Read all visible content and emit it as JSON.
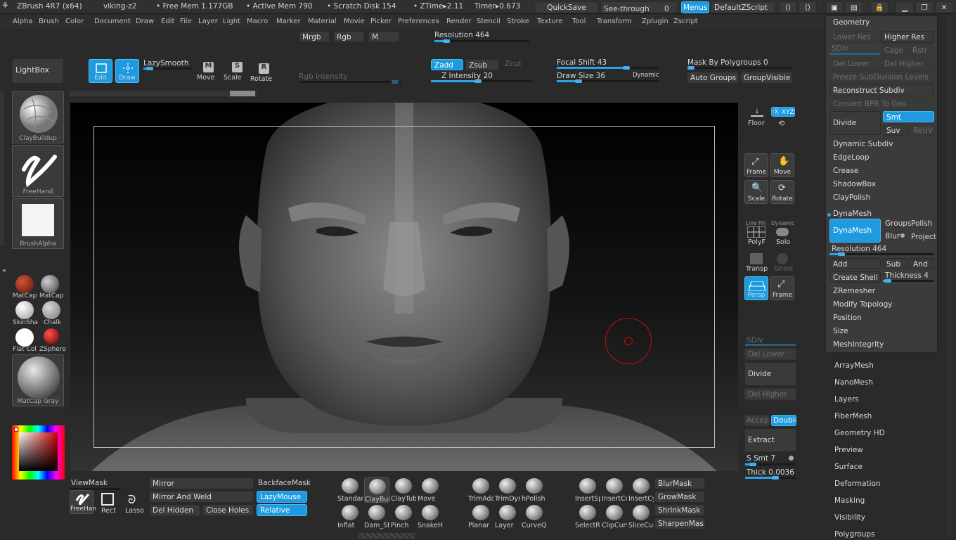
{
  "titlebar": {
    "app": "ZBrush 4R7 (x64)",
    "document": "viking-z2",
    "free_mem": "• Free Mem 1.177GB",
    "active_mem": "• Active Mem 790",
    "scratch": "• Scratch Disk 154",
    "ztime": "• ZTime▸2.11",
    "timer": "Timer▸0.673",
    "quicksave": "QuickSave",
    "see_through": "See-through",
    "see_through_value": "0",
    "menus": "Menus",
    "zscript": "DefaultZScript"
  },
  "menubar": [
    "Alpha",
    "Brush",
    "Color",
    "Document",
    "Draw",
    "Edit",
    "File",
    "Layer",
    "Light",
    "Macro",
    "Marker",
    "Material",
    "Movie",
    "Picker",
    "Preferences",
    "Render",
    "Stencil",
    "Stroke",
    "Texture",
    "Tool",
    "Transform",
    "Zplugin",
    "Zscript"
  ],
  "topshelf": {
    "mrgb": "Mrgb",
    "rgb": "Rgb",
    "m": "M",
    "resolution": "Resolution 464",
    "rgb_intensity": "Rgb Intensity",
    "lightbox": "LightBox",
    "edit": "Edit",
    "draw": "Draw",
    "lazysmooth": "LazySmooth",
    "move": "Move",
    "scale": "Scale",
    "rotate": "Rotate",
    "zadd": "Zadd",
    "zsub": "Zsub",
    "zcut": "Zcut",
    "z_intensity": "Z Intensity 20",
    "focal_shift": "Focal Shift 43",
    "draw_size": "Draw Size 36",
    "dynamic": "Dynamic",
    "mask_polygroups": "Mask By Polygroups 0",
    "auto_groups": "Auto Groups",
    "group_visible": "GroupVisible"
  },
  "leftshelf": {
    "brush": "ClayBuildup",
    "stroke": "FreeHand",
    "alpha": "BrushAlpha",
    "materials": [
      {
        "label": "MatCap",
        "color": "#8a2a1a"
      },
      {
        "label": "MatCap",
        "color": "#6e6e6e"
      },
      {
        "label": "SkinSha",
        "color": "#e6e6e6"
      },
      {
        "label": "Chalk",
        "color": "#9a9a9a"
      },
      {
        "label": "Flat Col",
        "color": "#ffffff"
      },
      {
        "label": "ZSphere",
        "color": "#b01818"
      }
    ],
    "current_material": "MatCap Gray"
  },
  "rightshelf": {
    "floor": "Floor",
    "xyz": "Ⓧ XYZ",
    "frame": "Frame",
    "move": "Move",
    "scale": "Scale",
    "rotate": "Rotate",
    "polyf": "PolyF",
    "line_fill": "Line Fill",
    "dynamic": "Dynamic",
    "solo": "Solo",
    "transp": "Transp",
    "ghost": "Ghost",
    "persp": "Persp",
    "frame2": "Frame",
    "sdiv": "SDiv",
    "del_lower": "Del Lower",
    "divide": "Divide",
    "del_higher": "Del Higher",
    "accept": "Accept",
    "double": "Double",
    "extract": "Extract",
    "s_smt": "S Smt 7",
    "thick": "Thick 0.0036"
  },
  "geometry": {
    "title": "Geometry",
    "lower_res": "Lower Res",
    "higher_res": "Higher Res",
    "sdiv": "SDiv",
    "cage": "Cage",
    "rstr": "Rstr",
    "del_lower": "Del Lower",
    "del_higher": "Del Higher",
    "freeze": "Freeze SubDivision Levels",
    "reconstruct": "Reconstruct Subdiv",
    "convert": "Convert BPR To Geo",
    "divide": "Divide",
    "smt": "Smt",
    "suv": "Suv",
    "reuv": "ReUV",
    "items": [
      "Dynamic Subdiv",
      "EdgeLoop",
      "Crease",
      "ShadowBox",
      "ClayPolish"
    ],
    "dynamesh_title": "DynaMesh",
    "dynamesh_btn": "DynaMesh",
    "groups": "Groups",
    "polish": "Polish",
    "blur": "Blur",
    "project": "Project",
    "resolution": "Resolution 464",
    "add": "Add",
    "sub": "Sub",
    "and": "And",
    "create_shell": "Create Shell",
    "thickness": "Thickness 4",
    "items2": [
      "ZRemesher",
      "Modify Topology",
      "Position",
      "Size",
      "MeshIntegrity"
    ]
  },
  "subpalettes": [
    "ArrayMesh",
    "NanoMesh",
    "Layers",
    "FiberMesh",
    "Geometry HD",
    "Preview",
    "Surface",
    "Deformation",
    "Masking",
    "Visibility",
    "Polygroups"
  ],
  "bottom": {
    "viewmask": "ViewMask",
    "mirror": "Mirror",
    "mirror_weld": "Mirror And Weld",
    "del_hidden": "Del Hidden",
    "close_holes": "Close Holes",
    "backface": "BackfaceMask",
    "lazymouse": "LazyMouse",
    "relative": "Relative",
    "freehand": "FreeHan",
    "rect": "Rect",
    "lasso": "Lasso",
    "brushes_row1": [
      "Standar",
      "ClayBuil",
      "ClayTub",
      "Move"
    ],
    "brushes_row2": [
      "Inflat",
      "Dam_St",
      "Pinch",
      "SnakeHo"
    ],
    "brushes_row3": [
      "TrimAda",
      "TrimDyr",
      "hPolish"
    ],
    "brushes_row4": [
      "Planar",
      "Layer",
      "CurveQ"
    ],
    "brushes_row5": [
      "InsertSp",
      "InsertCu",
      "InsertCy"
    ],
    "brushes_row6": [
      "SelectRe",
      "ClipCurv",
      "SliceCur"
    ],
    "blurmask": "BlurMask",
    "growmask": "GrowMask",
    "shrinkmask": "ShrinkMask",
    "sharpenmask": "SharpenMask"
  }
}
